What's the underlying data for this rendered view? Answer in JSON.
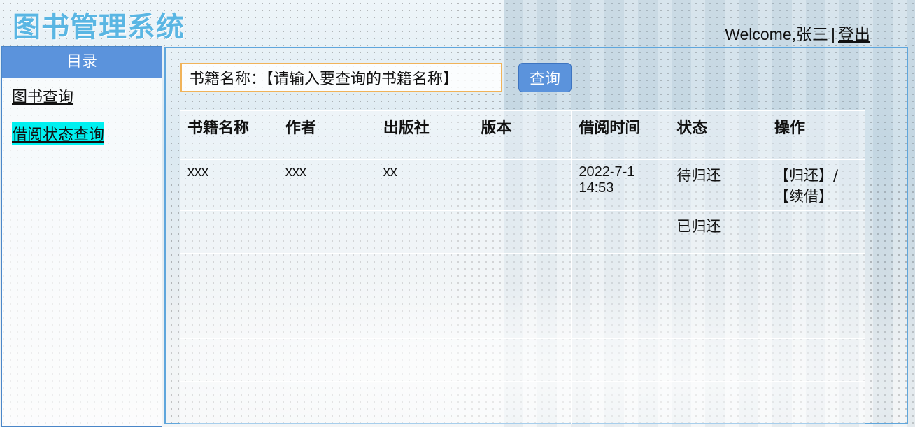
{
  "header": {
    "app_title": "图书管理系统",
    "welcome_text": "Welcome,张三",
    "separator": "|",
    "logout_label": "登出"
  },
  "sidebar": {
    "title": "目录",
    "items": [
      {
        "label": "图书查询"
      },
      {
        "label": "借阅状态查询"
      }
    ]
  },
  "search": {
    "value": "书籍名称：【请输入要查询的书籍名称】",
    "button_label": "查询"
  },
  "table": {
    "headers": [
      "书籍名称",
      "作者",
      "出版社",
      "版本",
      "借阅时间",
      "状态",
      "操作"
    ],
    "rows": [
      {
        "name": "xxx",
        "author": "xxx",
        "publisher": "xx",
        "edition": "",
        "time_date": "2022-7-1",
        "time_clock": "14:53",
        "status": "待归还",
        "action_return": "【归还】/",
        "action_renew": "【续借】"
      },
      {
        "name": "",
        "author": "",
        "publisher": "",
        "edition": "",
        "time_date": "",
        "time_clock": "",
        "status": "已归还",
        "action_return": "",
        "action_renew": ""
      }
    ]
  },
  "colors": {
    "title_blue": "#5ab6e3",
    "accent_blue": "#5b93dc",
    "active_highlight": "#00f0f0",
    "search_border": "#f0b35a"
  }
}
